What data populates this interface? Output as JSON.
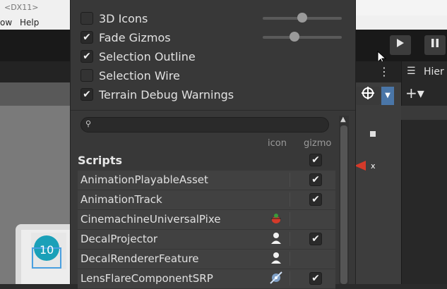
{
  "window": {
    "title_fragment": "<DX11>"
  },
  "menubar": {
    "items": [
      "ow",
      "Help"
    ]
  },
  "toolbar": {
    "play_icon": "play-icon",
    "pause_icon": "pause-icon"
  },
  "hierarchy": {
    "tab_label": "Hier",
    "add_label": "+▾"
  },
  "gizmos_panel": {
    "toggles": [
      {
        "label": "3D Icons",
        "checked": false,
        "has_slider": true,
        "slider_level": 0.5
      },
      {
        "label": "Fade Gizmos",
        "checked": true,
        "has_slider": true,
        "slider_level": 0.4
      },
      {
        "label": "Selection Outline",
        "checked": true,
        "has_slider": false
      },
      {
        "label": "Selection Wire",
        "checked": false,
        "has_slider": false
      },
      {
        "label": "Terrain Debug Warnings",
        "checked": true,
        "has_slider": false
      }
    ],
    "search": {
      "value": "",
      "placeholder": ""
    },
    "columns": {
      "icon": "icon",
      "gizmo": "gizmo"
    },
    "section_title": "Scripts",
    "header_gizmo_checked": true,
    "scripts": [
      {
        "name": "AnimationPlayableAsset",
        "icon": "",
        "gizmo": true
      },
      {
        "name": "AnimationTrack",
        "icon": "",
        "gizmo": true
      },
      {
        "name": "CinemachineUniversalPixe",
        "icon": "bug-icon",
        "gizmo": null
      },
      {
        "name": "DecalProjector",
        "icon": "person-icon",
        "gizmo": true
      },
      {
        "name": "DecalRendererFeature",
        "icon": "person-icon",
        "gizmo": null
      },
      {
        "name": "LensFlareComponentSRP",
        "icon": "lens-flare-icon",
        "gizmo": true
      }
    ]
  },
  "colors": {
    "accent": "#4a76a8",
    "panel_bg": "#383838",
    "row_bg": "#414141"
  }
}
